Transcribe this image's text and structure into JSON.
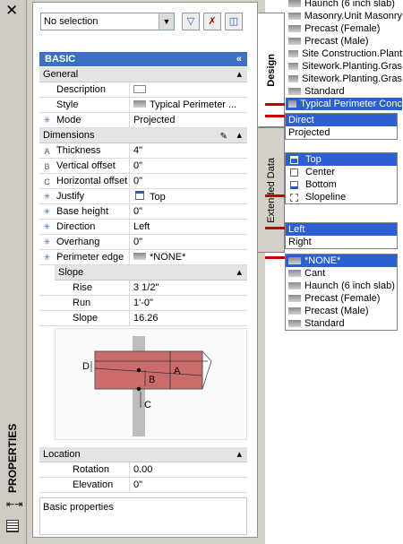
{
  "strip": {
    "close_glyph": "✕",
    "title": "PROPERTIES"
  },
  "tabs": {
    "design": "Design",
    "extended": "Extended Data"
  },
  "toolbar": {
    "selection": "No selection"
  },
  "basic": {
    "title": "BASIC",
    "general": {
      "title": "General",
      "rows": [
        {
          "name": "Description",
          "value": ""
        },
        {
          "name": "Style",
          "value": "Typical Perimeter ..."
        },
        {
          "name": "Mode",
          "value": "Projected"
        }
      ]
    },
    "dimensions": {
      "title": "Dimensions",
      "rows": [
        {
          "icon": "A",
          "name": "Thickness",
          "value": "4\""
        },
        {
          "icon": "B",
          "name": "Vertical offset",
          "value": "0\""
        },
        {
          "icon": "C",
          "name": "Horizontal offset",
          "value": "0\""
        },
        {
          "icon": "",
          "name": "Justify",
          "value": "Top"
        },
        {
          "icon": "",
          "name": "Base height",
          "value": "0\""
        },
        {
          "icon": "",
          "name": "Direction",
          "value": "Left"
        },
        {
          "icon": "",
          "name": "Overhang",
          "value": "0\""
        },
        {
          "icon": "",
          "name": "Perimeter edge",
          "value": "*NONE*"
        }
      ]
    },
    "slope": {
      "title": "Slope",
      "rows": [
        {
          "name": "Rise",
          "value": "3 1/2\""
        },
        {
          "name": "Run",
          "value": "1'-0\""
        },
        {
          "name": "Slope",
          "value": "16.26"
        }
      ]
    },
    "diagram": {
      "d": "D",
      "a": "A",
      "b": "B",
      "c": "C"
    },
    "location": {
      "title": "Location",
      "rows": [
        {
          "name": "Rotation",
          "value": "0.00"
        },
        {
          "name": "Elevation",
          "value": "0\""
        }
      ]
    },
    "footer": "Basic properties"
  },
  "dropdowns": {
    "styles": {
      "items": [
        "Haunch (6 inch slab)",
        "Masonry.Unit Masonry",
        "Precast (Female)",
        "Precast (Male)",
        "Site Construction.Plant",
        "Sitework.Planting.Gras",
        "Sitework.Planting.Gras",
        "Standard"
      ],
      "selected": "Typical Perimeter Conc"
    },
    "mode": {
      "items": [
        "Direct",
        "Projected"
      ],
      "selected": "Direct"
    },
    "justify": {
      "items": [
        "Top",
        "Center",
        "Bottom",
        "Slopeline"
      ],
      "selected": "Top"
    },
    "direction": {
      "items": [
        "Left",
        "Right"
      ],
      "selected": "Left"
    },
    "edge": {
      "items": [
        "*NONE*",
        "Cant",
        "Haunch (6 inch slab)",
        "Precast (Female)",
        "Precast (Male)",
        "Standard"
      ],
      "selected": "*NONE*"
    }
  },
  "colors": {
    "header_blue": "#3d6fc4",
    "selection_blue": "#2d5fd0",
    "callout_red": "#c00000",
    "slab_red": "#cc6b6b"
  }
}
